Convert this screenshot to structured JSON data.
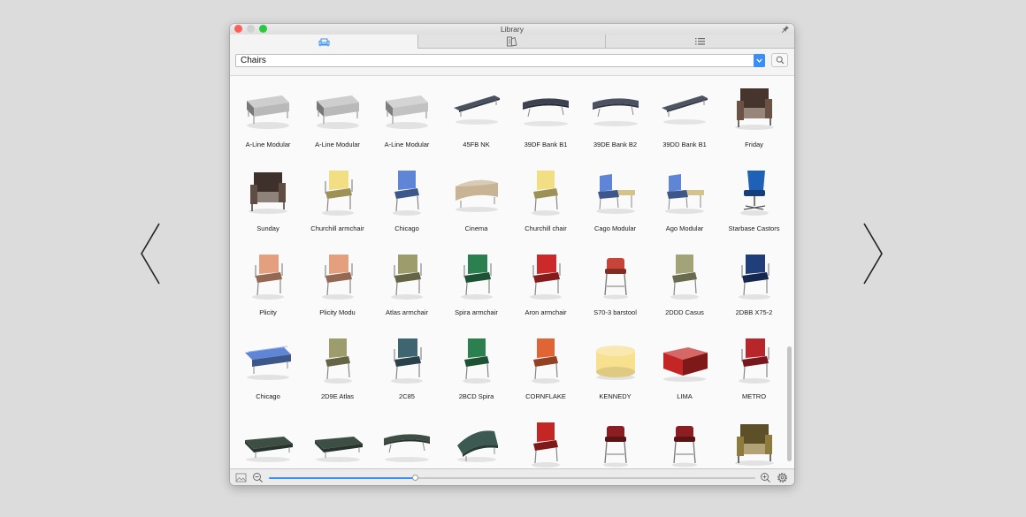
{
  "window": {
    "title": "Library",
    "traffic_lights": [
      "close",
      "minimize",
      "zoom"
    ]
  },
  "tabs": [
    {
      "icon": "sofa-icon",
      "selected": true
    },
    {
      "icon": "material-swatch-icon",
      "selected": false
    },
    {
      "icon": "list-icon",
      "selected": false
    }
  ],
  "filter": {
    "category": "Chairs",
    "search_icon": "search-icon"
  },
  "navigation": {
    "prev_icon": "chevron-left-icon",
    "next_icon": "chevron-right-icon"
  },
  "colors": {
    "accent": "#3b8ef2",
    "close": "#fc5f57",
    "zoom": "#2ac840"
  },
  "items": [
    {
      "label": "A-Line Modular",
      "kind": "sofa",
      "color": "#b9b9b9"
    },
    {
      "label": "A-Line Modular",
      "kind": "sofa",
      "color": "#b9b9b9"
    },
    {
      "label": "A-Line Modular",
      "kind": "sofa",
      "color": "#c2c2c2"
    },
    {
      "label": "45FB NK",
      "kind": "bench",
      "color": "#4a5260"
    },
    {
      "label": "39DF Bank B1",
      "kind": "bench-curved",
      "color": "#3c4250"
    },
    {
      "label": "39DE Bank B2",
      "kind": "bench-curved",
      "color": "#4b5362"
    },
    {
      "label": "39DD Bank B1",
      "kind": "bench",
      "color": "#4d5565"
    },
    {
      "label": "Friday",
      "kind": "armchair",
      "color": "#6b5244"
    },
    {
      "label": "Sunday",
      "kind": "armchair",
      "color": "#5f4c42"
    },
    {
      "label": "Churchill armchair",
      "kind": "chair-arms",
      "color": "#f2df84"
    },
    {
      "label": "Chicago",
      "kind": "chair",
      "color": "#5f86d6"
    },
    {
      "label": "Cinema",
      "kind": "ottoman",
      "color": "#c8b495"
    },
    {
      "label": "Churchill chair",
      "kind": "chair",
      "color": "#f2df84"
    },
    {
      "label": "Cago Modular",
      "kind": "chair-table",
      "color": "#5f86d6"
    },
    {
      "label": "Ago Modular",
      "kind": "chair-table",
      "color": "#5f86d6"
    },
    {
      "label": "Starbase Castors",
      "kind": "office",
      "color": "#2061b8"
    },
    {
      "label": "Plicity",
      "kind": "chair-arms",
      "color": "#e4a07e"
    },
    {
      "label": "Plicity Modu",
      "kind": "chair-arms",
      "color": "#e4a07e"
    },
    {
      "label": "Atlas armchair",
      "kind": "chair-arms",
      "color": "#9c9c6c"
    },
    {
      "label": "Spira armchair",
      "kind": "chair-arms",
      "color": "#2c8050"
    },
    {
      "label": "Aron armchair",
      "kind": "chair-arms",
      "color": "#cc2a2a"
    },
    {
      "label": "S70-3 barstool",
      "kind": "stool",
      "color": "#c64538"
    },
    {
      "label": "2DDD Casus",
      "kind": "chair",
      "color": "#a3a37a"
    },
    {
      "label": "2DBB X75-2",
      "kind": "chair-arms",
      "color": "#1f3e7a"
    },
    {
      "label": "Chicago",
      "kind": "bench-slat",
      "color": "#5f86d6"
    },
    {
      "label": "2D9E Atlas",
      "kind": "chair",
      "color": "#9c9c6c"
    },
    {
      "label": "2C85",
      "kind": "chair-arms",
      "color": "#3f6670"
    },
    {
      "label": "2BCD Spira",
      "kind": "chair",
      "color": "#2c8050"
    },
    {
      "label": "CORNFLAKE",
      "kind": "chair",
      "color": "#e06434"
    },
    {
      "label": "KENNEDY",
      "kind": "pouf",
      "color": "#f7e08e"
    },
    {
      "label": "LIMA",
      "kind": "cube",
      "color": "#c42626"
    },
    {
      "label": "METRO",
      "kind": "chair-arms",
      "color": "#b8252b"
    },
    {
      "label": "",
      "kind": "bench-pad",
      "color": "#3d4e45"
    },
    {
      "label": "",
      "kind": "bench-pad",
      "color": "#3d4e45"
    },
    {
      "label": "",
      "kind": "bench-curved",
      "color": "#3d4e45"
    },
    {
      "label": "",
      "kind": "lounge",
      "color": "#3d5a52"
    },
    {
      "label": "",
      "kind": "chair",
      "color": "#c42626"
    },
    {
      "label": "",
      "kind": "stool",
      "color": "#8a1e22"
    },
    {
      "label": "",
      "kind": "stool",
      "color": "#8a1e22"
    },
    {
      "label": "",
      "kind": "armchair",
      "color": "#8f7a3e"
    }
  ],
  "bottombar": {
    "left_icon": "image-icon",
    "zoom_out_icon": "zoom-out-icon",
    "zoom_in_icon": "zoom-in-icon",
    "settings_icon": "gear-icon",
    "zoom_level": 0.3
  }
}
